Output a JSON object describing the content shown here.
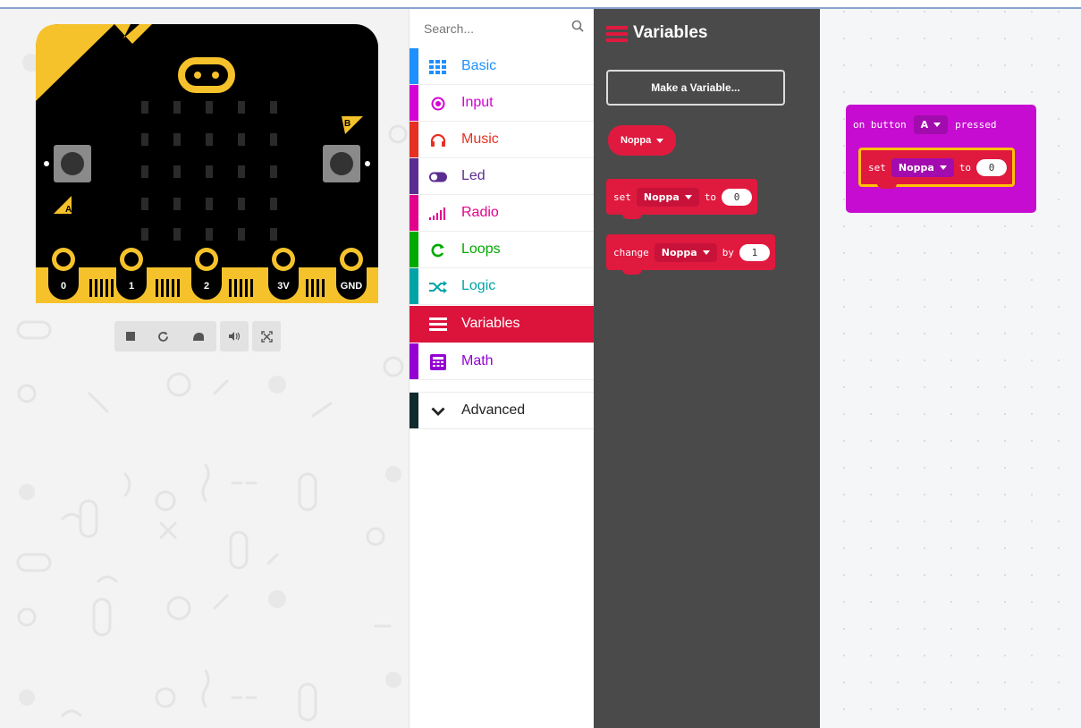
{
  "search": {
    "placeholder": "Search..."
  },
  "simulator": {
    "pins": [
      "0",
      "1",
      "2",
      "3V",
      "GND"
    ],
    "button_a": "A",
    "button_b": "B",
    "toolbar_icons": [
      "stop-icon",
      "restart-icon",
      "slowmo-icon",
      "mute-icon",
      "fullscreen-icon"
    ]
  },
  "toolbox": {
    "categories": [
      {
        "label": "Basic",
        "color": "#1e90ff",
        "icon": "grid-icon"
      },
      {
        "label": "Input",
        "color": "#d400d4",
        "icon": "target-icon"
      },
      {
        "label": "Music",
        "color": "#e63022",
        "icon": "headphones-icon"
      },
      {
        "label": "Led",
        "color": "#5c2d91",
        "icon": "toggle-icon"
      },
      {
        "label": "Radio",
        "color": "#e3008c",
        "icon": "signal-icon"
      },
      {
        "label": "Loops",
        "color": "#00aa00",
        "icon": "loop-icon"
      },
      {
        "label": "Logic",
        "color": "#00a4a6",
        "icon": "shuffle-icon"
      },
      {
        "label": "Variables",
        "color": "#dc143c",
        "icon": "list-icon"
      },
      {
        "label": "Math",
        "color": "#9400d3",
        "icon": "calculator-icon"
      }
    ],
    "advanced": {
      "label": "Advanced",
      "color": "#3c3c3c",
      "icon": "chevron-down-icon"
    }
  },
  "flyout": {
    "title": "Variables",
    "make_variable": "Make a Variable...",
    "variable_pill": "Noppa",
    "set_block": {
      "kw1": "set",
      "var": "Noppa",
      "kw2": "to",
      "value": "0"
    },
    "change_block": {
      "kw1": "change",
      "var": "Noppa",
      "kw2": "by",
      "value": "1"
    }
  },
  "workspace": {
    "event_block": {
      "kw1": "on button",
      "button": "A",
      "kw2": "pressed"
    },
    "set_block": {
      "kw1": "set",
      "var": "Noppa",
      "kw2": "to",
      "value": "0"
    }
  },
  "colors": {
    "variables": "#e0193f",
    "input": "#c60cd1",
    "highlight": "#ffc107"
  }
}
